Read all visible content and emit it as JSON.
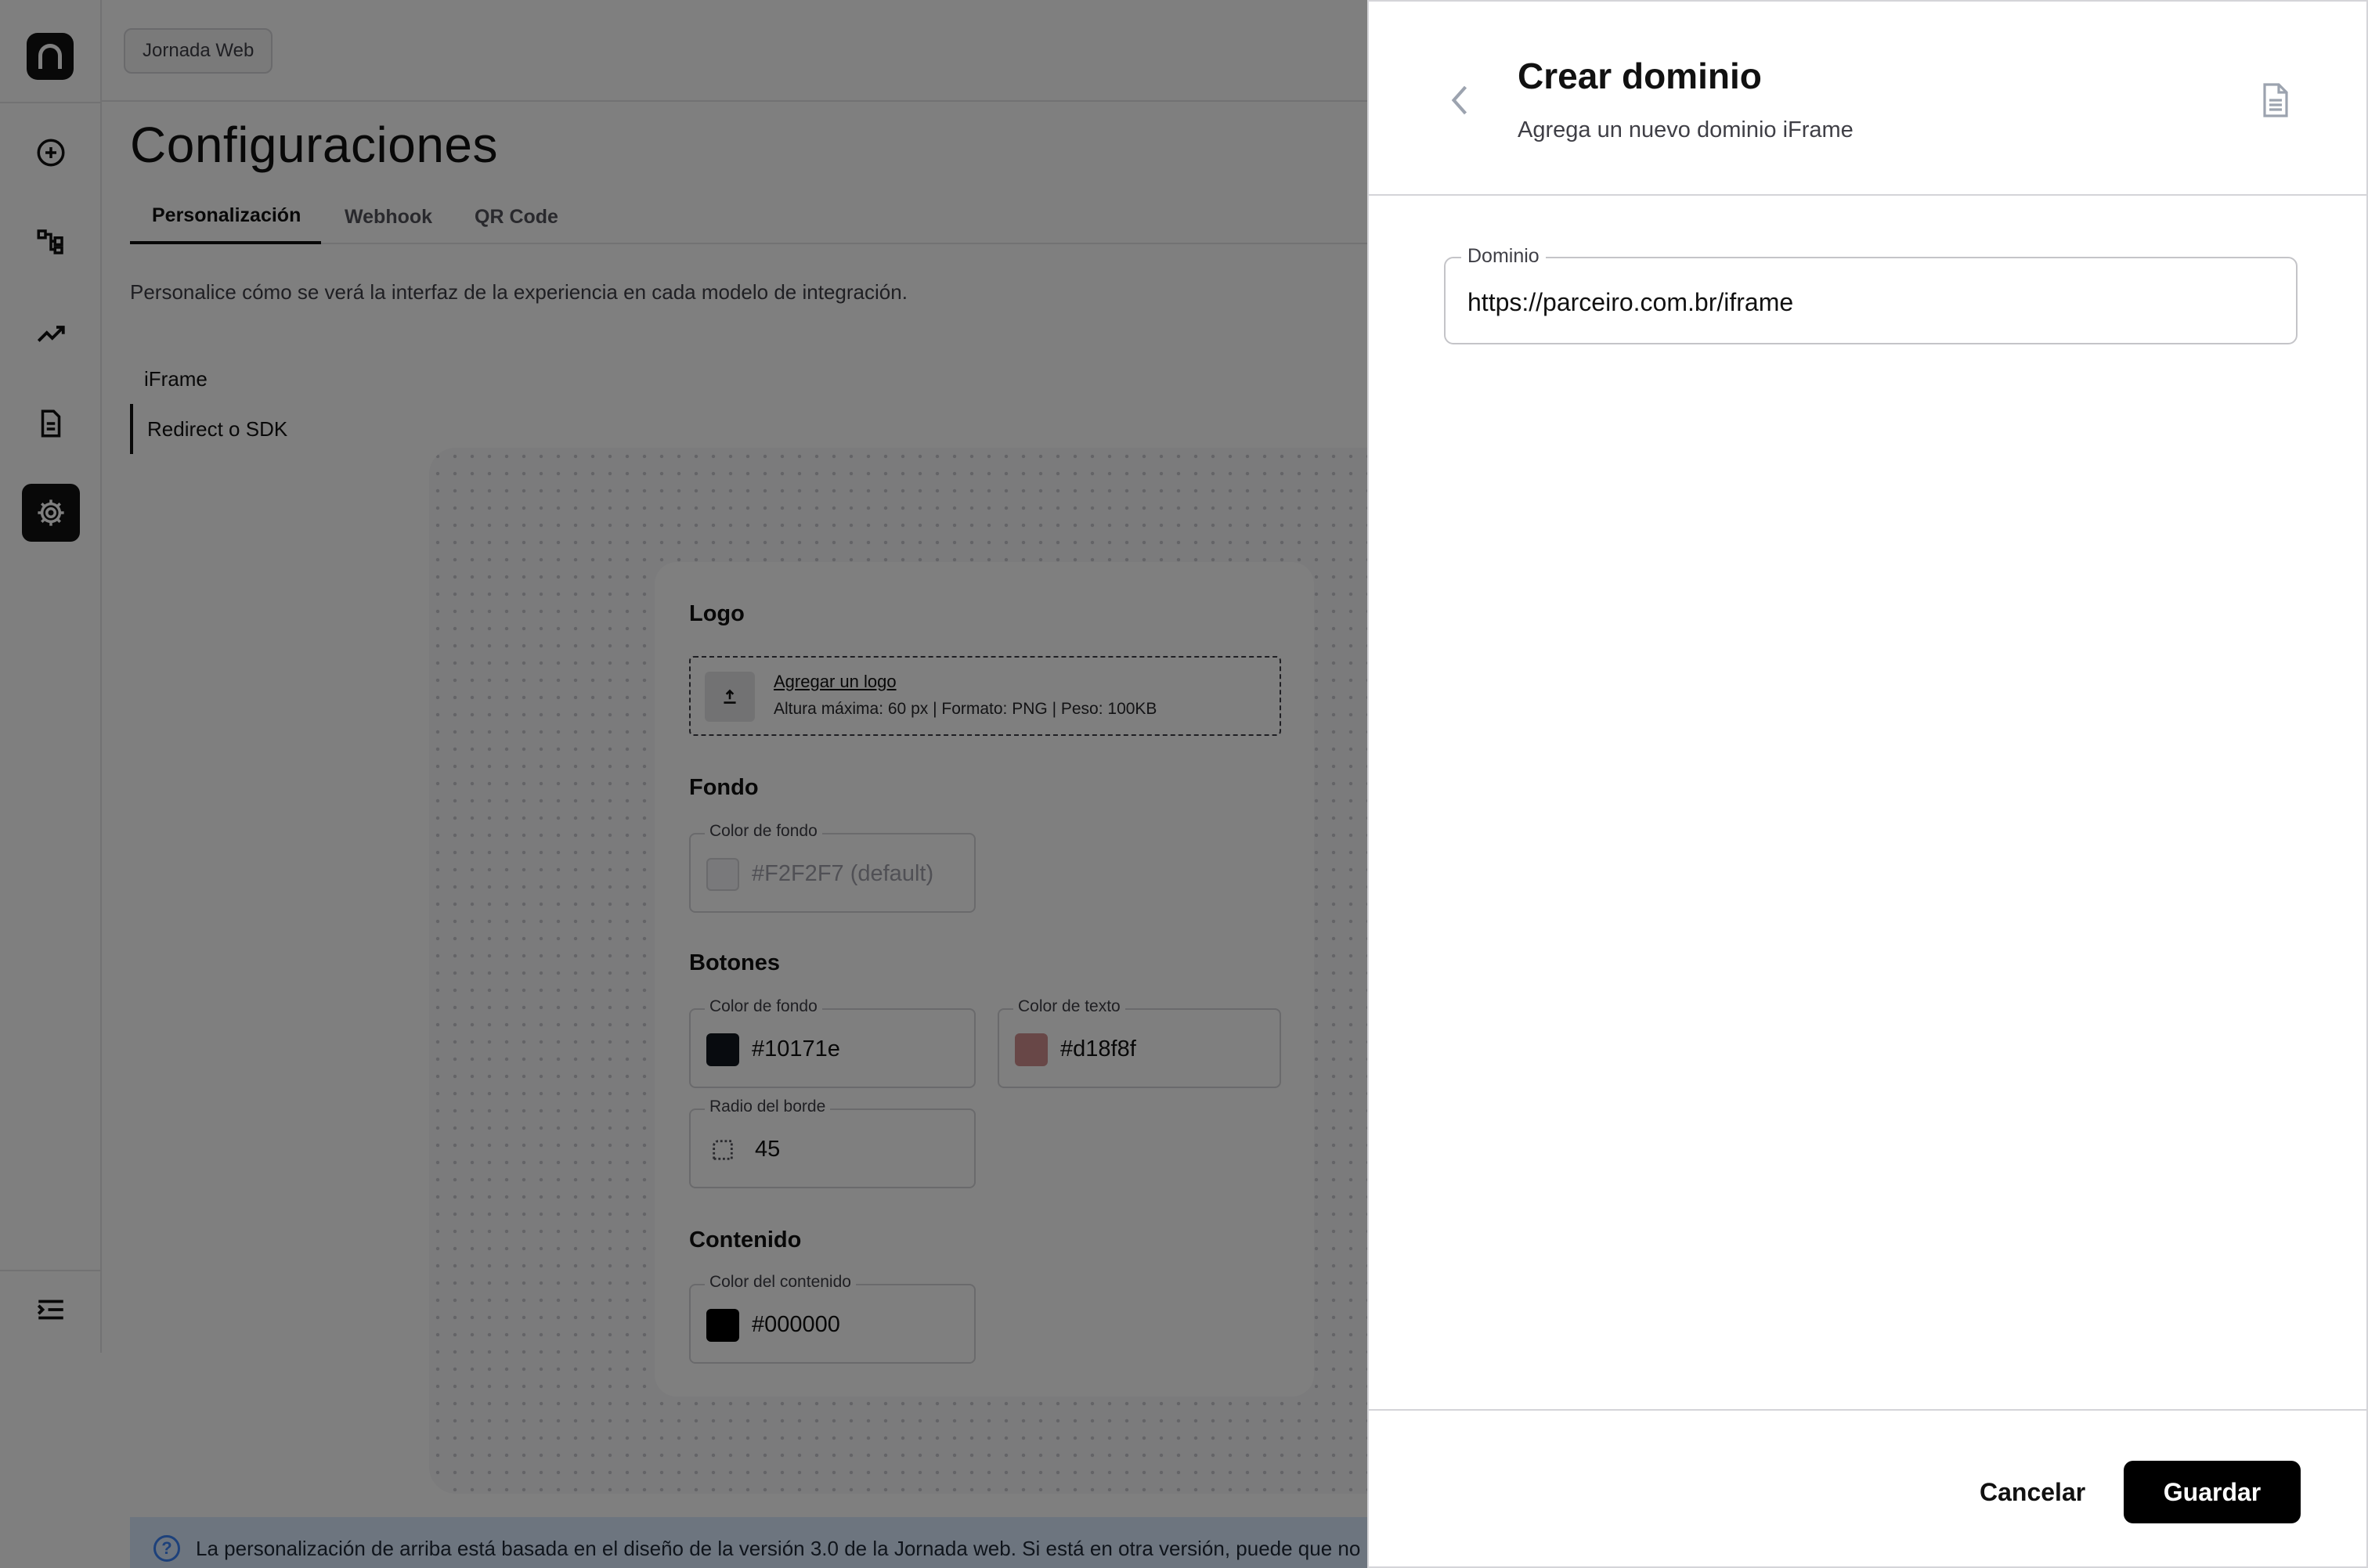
{
  "breadcrumb": {
    "label": "Jornada Web"
  },
  "page": {
    "title": "Configuraciones",
    "tabs": [
      {
        "label": "Personalización",
        "active": true
      },
      {
        "label": "Webhook",
        "active": false
      },
      {
        "label": "QR Code",
        "active": false
      }
    ],
    "intro": "Personalice cómo se verá la interfaz de la experiencia en cada modelo de integración.",
    "sub_nav": [
      {
        "label": "iFrame",
        "active": false
      },
      {
        "label": "Redirect o SDK",
        "active": true
      }
    ]
  },
  "sidebar": {
    "icons": [
      "add-circle-icon",
      "workflow-icon",
      "analytics-icon",
      "document-icon",
      "settings-icon",
      "collapse-menu-icon"
    ],
    "active": "settings-icon"
  },
  "preview": {
    "logo": {
      "heading": "Logo",
      "link": "Agregar un logo",
      "info": "Altura máxima: 60 px | Formato: PNG | Peso: 100KB"
    },
    "fondo": {
      "heading": "Fondo",
      "color_label": "Color de fondo",
      "color_value": "#F2F2F7 (default)",
      "swatch": "#F2F2F7"
    },
    "botones": {
      "heading": "Botones",
      "bg_label": "Color de fondo",
      "bg_value": "#10171e",
      "text_label": "Color de texto",
      "text_value": "#d18f8f",
      "radius_label": "Radio del borde",
      "radius_value": "45"
    },
    "contenido": {
      "heading": "Contenido",
      "color_label": "Color del contenido",
      "color_value": "#000000"
    }
  },
  "info_bar": {
    "text": "La personalización de arriba está basada en el diseño de la versión 3.0 de la Jornada web. Si está en otra versión, puede que no re"
  },
  "drawer": {
    "title": "Crear dominio",
    "subtitle": "Agrega un nuevo dominio iFrame",
    "field_label": "Dominio",
    "field_value": "https://parceiro.com.br/iframe",
    "cancel": "Cancelar",
    "save": "Guardar"
  },
  "colors": {
    "overlay": "rgba(0,0,0,0.5)",
    "primary": "#000000",
    "info_bg": "#dbeafe",
    "info_accent": "#3b82f6"
  }
}
